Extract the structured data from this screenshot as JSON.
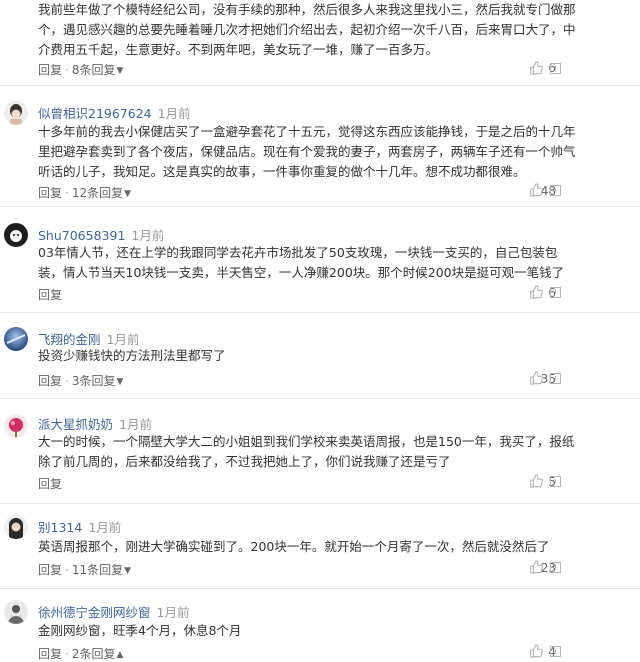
{
  "comments": [
    {
      "username": "",
      "time": "",
      "body": "我前些年做了个模特经纪公司，没有手续的那种，然后很多人来我这里找小三，然后我就专门做那个，遇见感兴趣的总要先睡着睡几次才把她们介绍出去，起初介绍一次千八百，后来胃口大了，中介费用五千起，生意更好。不到两年吧，美女玩了一堆，赚了一百多万。",
      "reply_label": "回复",
      "replies_label": "8条回复",
      "likes": "6"
    },
    {
      "username": "似曾相识21967624",
      "time": "1月前",
      "body": "十多年前的我去小保健店买了一盒避孕套花了十五元，觉得这东西应该能挣钱，于是之后的十几年里把避孕套卖到了各个夜店，保健品店。现在有个爱我的妻子，两套房子，两辆车子还有一个帅气听话的儿子，我知足。这是真实的故事，一件事你重复的做个十几年。想不成功都很难。",
      "reply_label": "回复",
      "replies_label": "12条回复",
      "likes": "48"
    },
    {
      "username": "Shu70658391",
      "time": "1月前",
      "body": "03年情人节，还在上学的我跟同学去花卉市场批发了50支玫瑰，一块钱一支买的，自己包装包装，情人节当天10块钱一支卖，半天售空，一人净赚200块。那个时候200块是挺可观一笔钱了",
      "reply_label": "回复",
      "replies_label": "",
      "likes": "6"
    },
    {
      "username": "飞翔的金刚",
      "time": "1月前",
      "body": "投资少赚钱快的方法刑法里都写了",
      "reply_label": "回复",
      "replies_label": "3条回复",
      "likes": "35"
    },
    {
      "username": "派大星抓奶奶",
      "time": "1月前",
      "body": "大一的时候，一个隔壁大学大二的小姐姐到我们学校来卖英语周报，也是150一年，我买了，报纸除了前几周的，后来都没给我了，不过我把她上了，你们说我赚了还是亏了",
      "reply_label": "回复",
      "replies_label": "",
      "likes": "5"
    },
    {
      "username": "别1314",
      "time": "1月前",
      "body": "英语周报那个，刚进大学确实碰到了。200块一年。就开始一个月寄了一次，然后就没然后了",
      "reply_label": "回复",
      "replies_label": "11条回复",
      "likes": "23"
    },
    {
      "username": "徐州德宁金刚网纱窗",
      "time": "1月前",
      "body": "金刚网纱窗，旺季4个月，休息8个月",
      "reply_label": "回复",
      "replies_label": "2条回复",
      "likes": "4"
    }
  ]
}
